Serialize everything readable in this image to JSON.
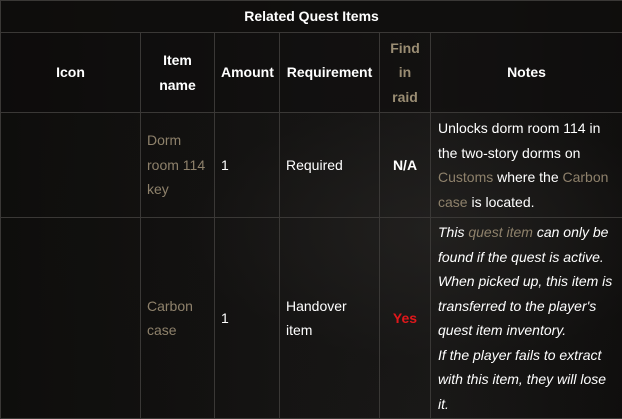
{
  "table_title": "Related Quest Items",
  "headers": {
    "icon": "Icon",
    "item_name_line1": "Item",
    "item_name_line2": "name",
    "amount": "Amount",
    "requirement": "Requirement",
    "find_in_raid_line1": "Find",
    "find_in_raid_line2": "in",
    "find_in_raid_line3": "raid",
    "notes": "Notes"
  },
  "rows": [
    {
      "item_name_line1": "Dorm",
      "item_name_line2": "room 114",
      "item_name_line3": "key",
      "amount": "1",
      "requirement": "Required",
      "find_in_raid": "N/A",
      "notes": {
        "part1": "Unlocks dorm room 114 in the two-story dorms on ",
        "link1": "Customs",
        "part2": " where the ",
        "link2": "Carbon case",
        "part3": " is located."
      }
    },
    {
      "item_name_line1": "Carbon",
      "item_name_line2": "case",
      "amount": "1",
      "requirement_line1": "Handover",
      "requirement_line2": "item",
      "find_in_raid": "Yes",
      "notes": {
        "part1": "This ",
        "link1": "quest item",
        "part2": " can only be found if the quest is active. When picked up, this item is transferred to the player's quest item inventory.",
        "part3": "If the player fails to extract with this item, they will lose it."
      }
    }
  ],
  "colors": {
    "link": "#8e816b",
    "yes": "#e0171b",
    "border": "#3a3836"
  }
}
